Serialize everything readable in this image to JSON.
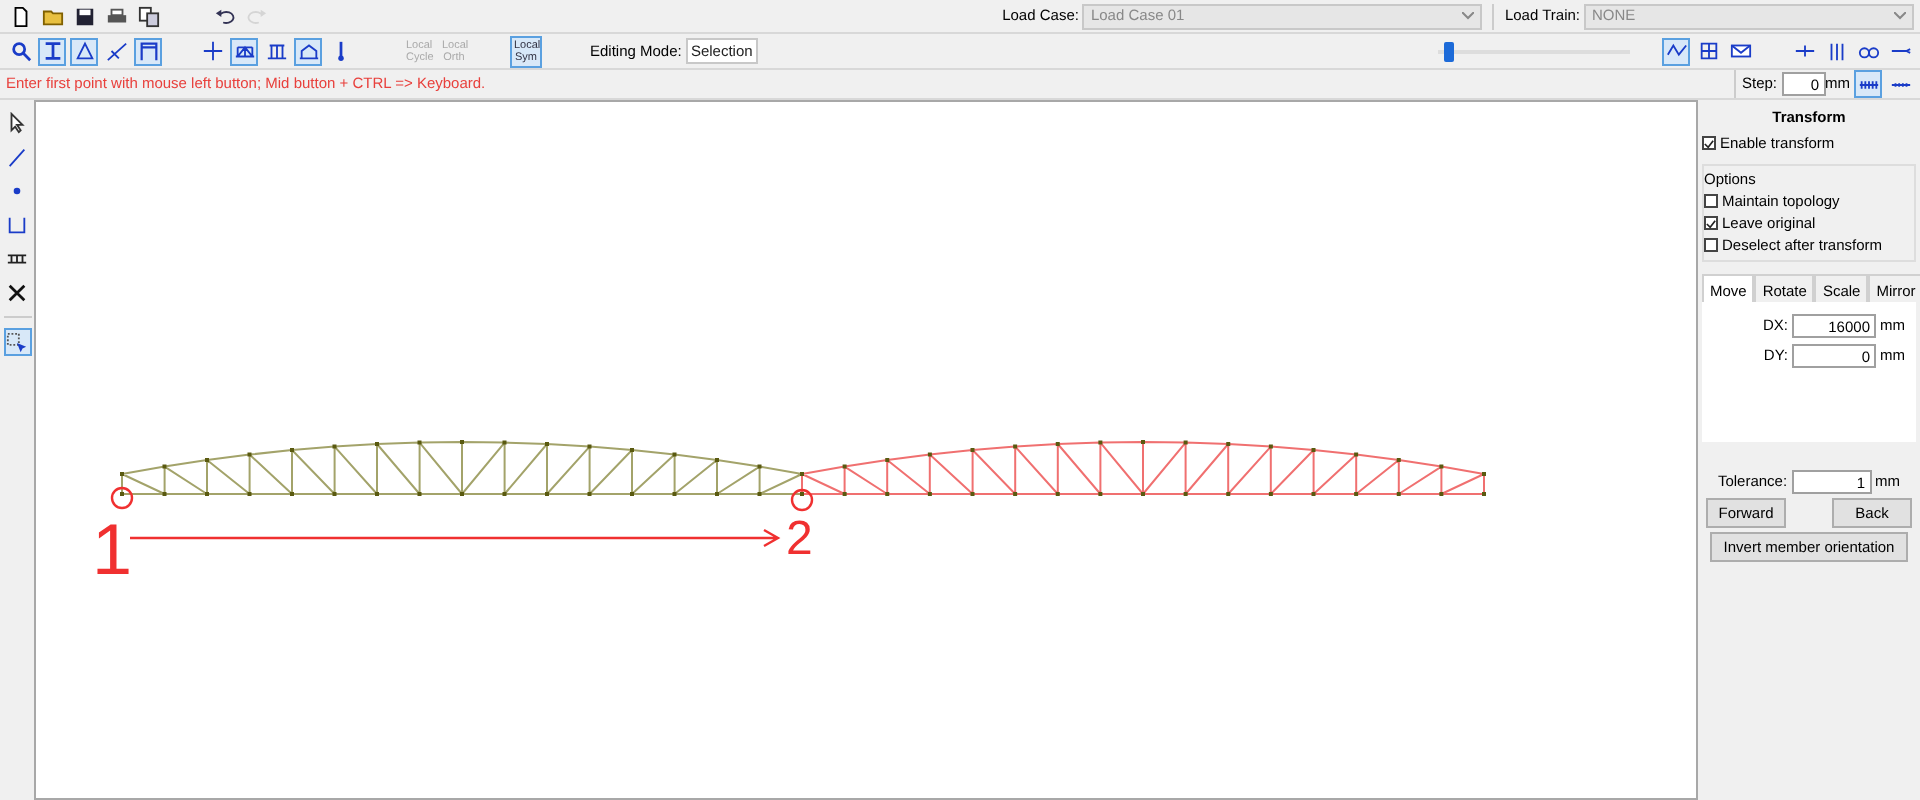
{
  "toolbar_top": {
    "tools": [
      {
        "disabled": false
      },
      {
        "disabled": false
      },
      {
        "disabled": false
      },
      {
        "disabled": false
      },
      {
        "disabled": false
      },
      {
        "disabled": false
      },
      {
        "disabled": true
      }
    ],
    "load_case": {
      "label": "Load Case:",
      "value": "Load Case 01",
      "disabled": true
    },
    "load_train": {
      "label": "Load Train:",
      "value": "NONE",
      "disabled": true
    }
  },
  "toolbar_tools": {
    "tools": [
      {
        "selected": false
      },
      {
        "selected": true
      },
      {
        "selected": true
      },
      {
        "selected": false
      },
      {
        "selected": true
      },
      {
        "selected": false
      },
      {
        "selected": true
      },
      {
        "selected": false
      },
      {
        "selected": true
      },
      {
        "selected": false
      }
    ],
    "local_buttons": [
      {
        "label": "Local Cycle",
        "selected": false,
        "disabled": true
      },
      {
        "label": "Local Orth",
        "selected": false,
        "disabled": true
      },
      {
        "label": "Local Sym",
        "selected": true,
        "disabled": false
      }
    ],
    "editing_mode": {
      "label": "Editing Mode:",
      "value": "Selection"
    },
    "zoom_slider": {
      "level": 0.05
    },
    "view_tools": [
      {
        "selected": true
      },
      {
        "selected": false
      },
      {
        "selected": false
      }
    ],
    "misc_tools": [
      {
        "selected": false
      },
      {
        "selected": false
      },
      {
        "selected": false
      },
      {
        "selected": false
      }
    ]
  },
  "status_message": "Enter first point with mouse left button; Mid button + CTRL => Keyboard.",
  "step": {
    "label": "Step:",
    "value": "0",
    "unit": "mm",
    "tools": [
      {
        "selected": true
      },
      {
        "selected": false
      }
    ]
  },
  "side_tools": [
    {
      "selected": false
    },
    {
      "selected": false
    },
    {
      "selected": false
    },
    {
      "selected": false
    },
    {
      "selected": false
    },
    {
      "selected": false
    },
    {
      "selected": true
    }
  ],
  "canvas": {
    "structures": [
      {
        "color": "#a3a36a"
      },
      {
        "color": "#f07070"
      }
    ],
    "annotations": [
      {
        "label": "1"
      },
      {
        "label": "2"
      }
    ]
  },
  "transform_panel": {
    "title": "Transform",
    "enable": {
      "label": "Enable transform",
      "checked": true
    },
    "options_title": "Options",
    "options": [
      {
        "label": "Maintain topology",
        "checked": false
      },
      {
        "label": "Leave original",
        "checked": true
      },
      {
        "label": "Deselect after transform",
        "checked": false
      }
    ],
    "tabs": [
      {
        "label": "Move",
        "selected": true
      },
      {
        "label": "Rotate",
        "selected": false
      },
      {
        "label": "Scale",
        "selected": false
      },
      {
        "label": "Mirror",
        "selected": false
      }
    ],
    "fields": [
      {
        "label": "DX:",
        "value": "16000",
        "unit": "mm"
      },
      {
        "label": "DY:",
        "value": "0",
        "unit": "mm"
      }
    ],
    "tolerance": {
      "label": "Tolerance:",
      "value": "1",
      "unit": "mm"
    },
    "buttons": [
      {
        "label": "Forward"
      },
      {
        "label": "Back"
      },
      {
        "label": "Invert member orientation"
      }
    ]
  }
}
